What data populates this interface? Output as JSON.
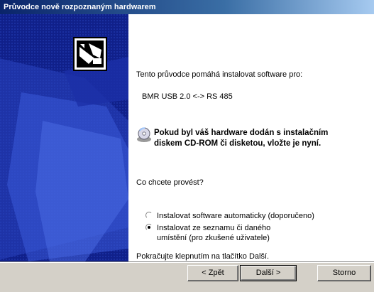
{
  "window": {
    "title": "Průvodce nově rozpoznaným hardwarem"
  },
  "content": {
    "intro_text": "Tento průvodce pomáhá instalovat software pro:",
    "device_name": "BMR USB 2.0 <-> RS 485",
    "cd_message_line1": "Pokud byl váš hardware dodán s instalačním",
    "cd_message_line2": "diskem CD-ROM či disketou, vložte je nyní.",
    "question": "Co chcete provést?",
    "options": [
      {
        "label_line1": "Instalovat software automaticky (doporučeno)",
        "label_line2": "",
        "selected": false
      },
      {
        "label_line1": "Instalovat ze seznamu či daného",
        "label_line2": "umístění (pro zkušené uživatele)",
        "selected": true
      }
    ],
    "continue_text": "Pokračujte klepnutím na tlačítko Další."
  },
  "buttons": {
    "back": "< Zpět",
    "next": "Další >",
    "cancel": "Storno"
  },
  "colors": {
    "title_bar": "#0a246a",
    "left_panel": "#10208a",
    "dialog_bg": "#d4d0c8"
  },
  "icons": {
    "hardware": "hardware-card-icon",
    "cd": "cd-rom-icon"
  }
}
